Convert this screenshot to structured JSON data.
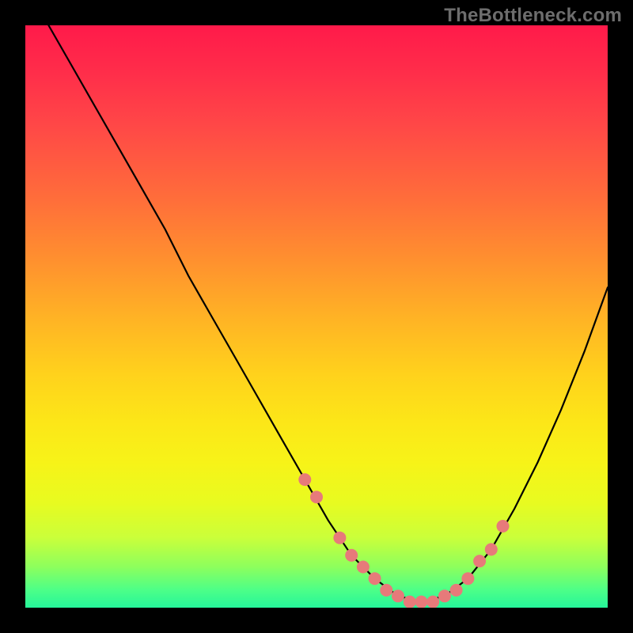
{
  "watermark": "TheBottleneck.com",
  "chart_data": {
    "type": "line",
    "title": "",
    "xlabel": "",
    "ylabel": "",
    "xlim": [
      0,
      100
    ],
    "ylim": [
      0,
      100
    ],
    "grid": false,
    "legend": false,
    "series": [
      {
        "name": "bottleneck-curve",
        "x": [
          4,
          8,
          12,
          16,
          20,
          24,
          28,
          32,
          36,
          40,
          44,
          48,
          52,
          56,
          60,
          64,
          68,
          72,
          76,
          80,
          84,
          88,
          92,
          96,
          100
        ],
        "y": [
          100,
          93,
          86,
          79,
          72,
          65,
          57,
          50,
          43,
          36,
          29,
          22,
          15,
          9,
          5,
          2,
          1,
          2,
          5,
          10,
          17,
          25,
          34,
          44,
          55
        ]
      }
    ],
    "highlight_points": {
      "name": "scatter-dots",
      "x": [
        48,
        50,
        54,
        56,
        58,
        60,
        62,
        64,
        66,
        68,
        70,
        72,
        74,
        76,
        78,
        80,
        82
      ],
      "y": [
        22,
        19,
        12,
        9,
        7,
        5,
        3,
        2,
        1,
        1,
        1,
        2,
        3,
        5,
        8,
        10,
        14
      ]
    },
    "gradient_band": {
      "description": "vertical red→yellow→green heat gradient filling plot area; green at bottom indicates optimal/low-bottleneck zone",
      "stops": [
        {
          "pos": 0.0,
          "color": "#ff1a4a"
        },
        {
          "pos": 0.5,
          "color": "#ffb225"
        },
        {
          "pos": 0.78,
          "color": "#f7f318"
        },
        {
          "pos": 1.0,
          "color": "#25f59a"
        }
      ]
    }
  }
}
